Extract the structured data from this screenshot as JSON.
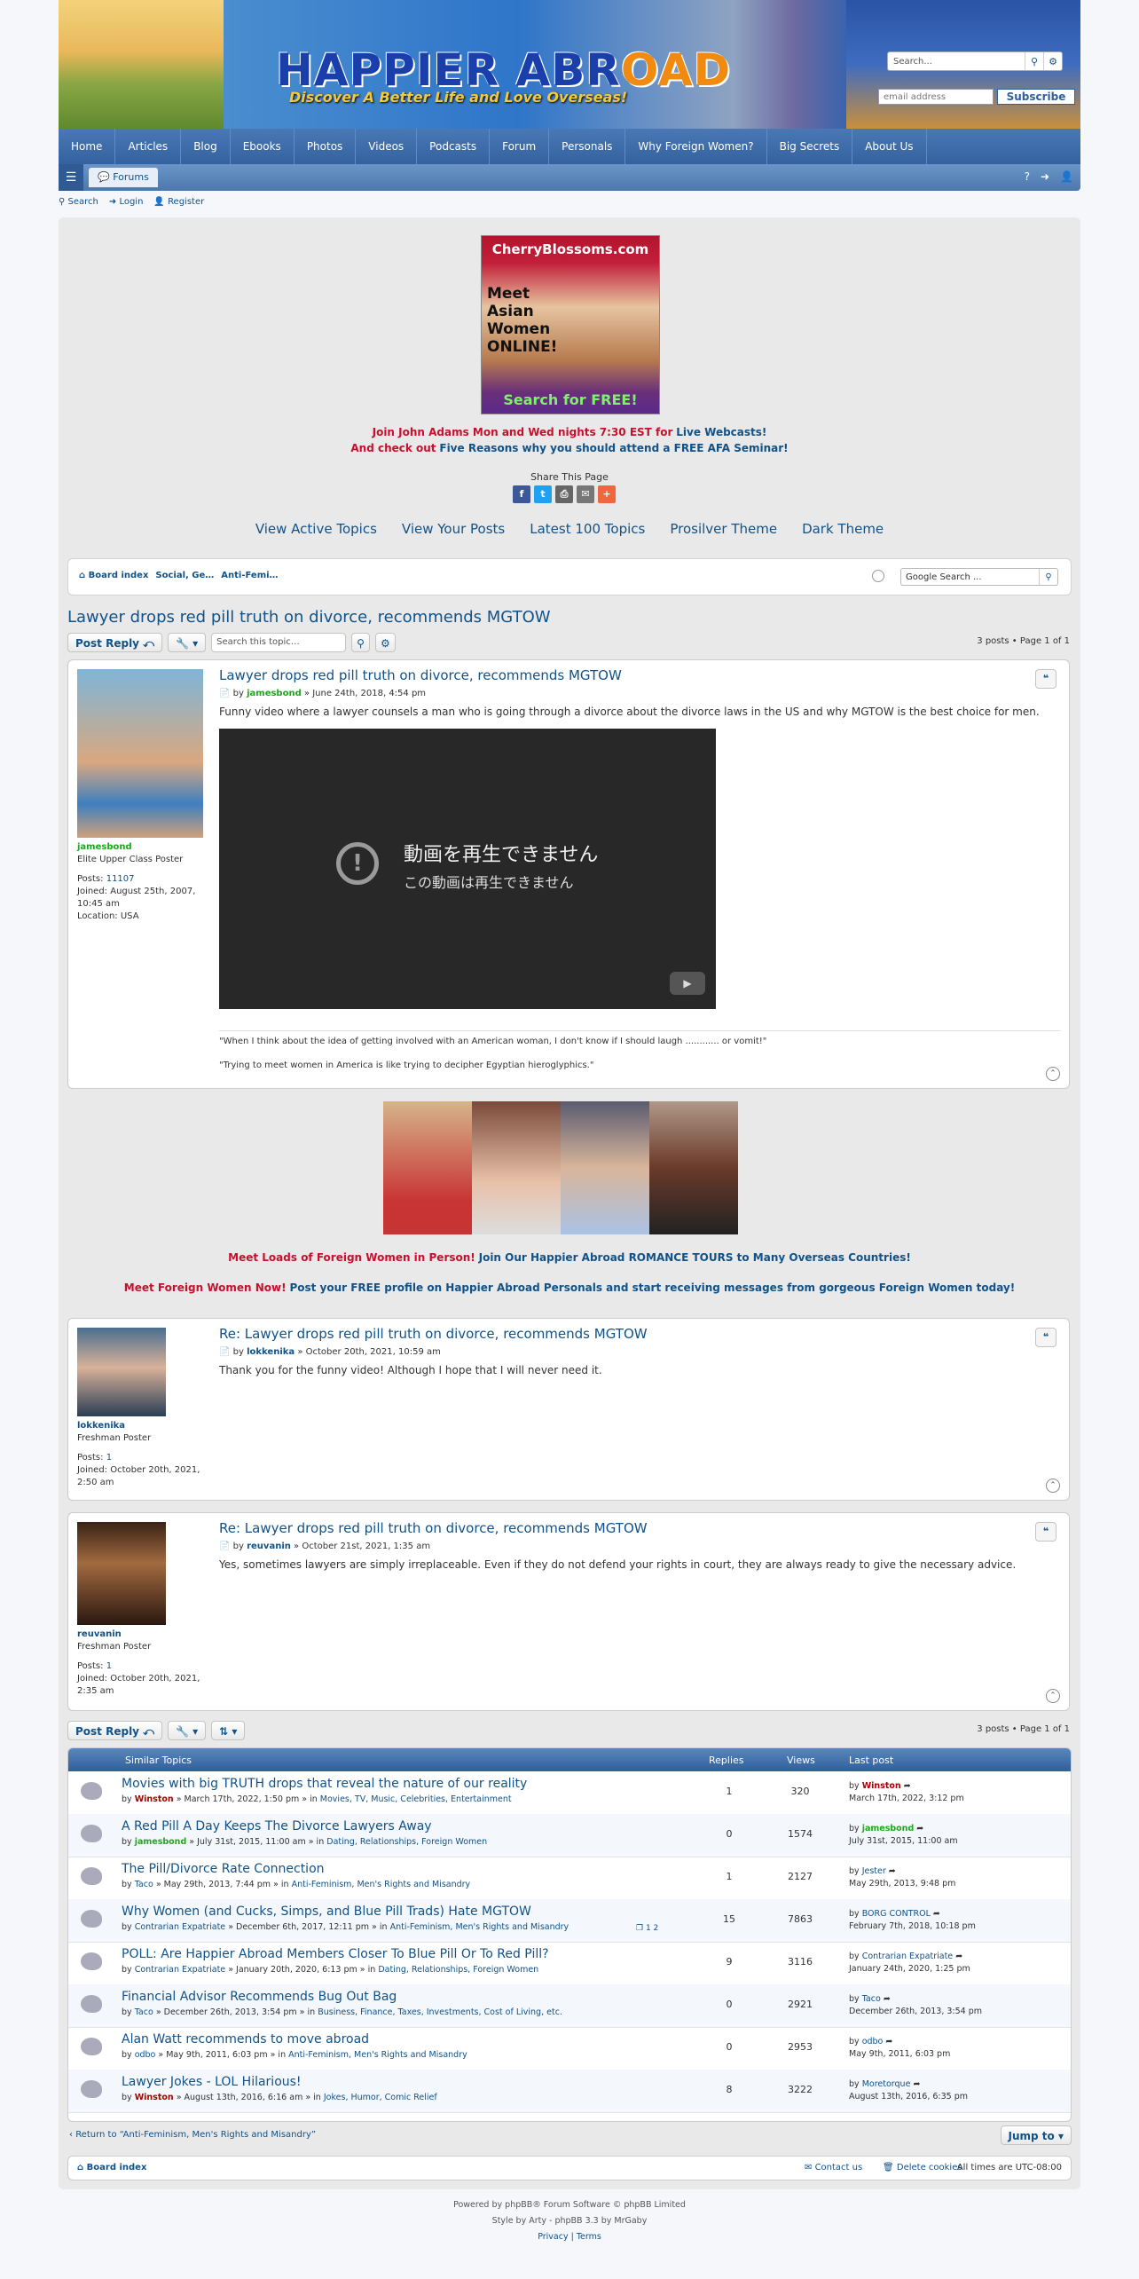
{
  "banner": {
    "logo_a": "HAPPIER ABR",
    "logo_b": "OAD",
    "tagline": "Discover A Better Life and Love Overseas!",
    "search_placeholder": "Search...",
    "email_placeholder": "email address",
    "subscribe": "Subscribe"
  },
  "topnav": [
    "Home",
    "Articles",
    "Blog",
    "Ebooks",
    "Photos",
    "Videos",
    "Podcasts",
    "Forum",
    "Personals",
    "Why Foreign Women?",
    "Big Secrets",
    "About Us"
  ],
  "subnav": {
    "forums": "Forums"
  },
  "quick": {
    "search": "Search",
    "login": "Login",
    "register": "Register"
  },
  "ad1": {
    "site": "CherryBlossoms.com",
    "line": "Meet Asian Women ONLINE!",
    "cta": "Search for FREE!"
  },
  "promo": {
    "l1a": "Join John Adams Mon and Wed nights 7:30 EST for",
    "l1b": "Live Webcasts!",
    "l2a": "And check out",
    "l2b": "Five Reasons why you should attend a FREE AFA Seminar!",
    "share": "Share This Page"
  },
  "links": [
    "View Active Topics",
    "View Your Posts",
    "Latest 100 Topics",
    "Prosilver Theme",
    "Dark Theme"
  ],
  "breadcrumb": {
    "board": "Board index",
    "c1": "Social, Ge…",
    "c2": "Anti-Femi…",
    "google": "Google Search ..."
  },
  "topic": {
    "title": "Lawyer drops red pill truth on divorce, recommends MGTOW",
    "post_reply": "Post Reply",
    "search_placeholder": "Search this topic…",
    "pagination": "3 posts • Page 1 of 1"
  },
  "posts": [
    {
      "title": "Lawyer drops red pill truth on divorce, recommends MGTOW",
      "by": "by",
      "author": "jamesbond",
      "date": "» June 24th, 2018, 4:54 pm",
      "text": "Funny video where a lawyer counsels a man who is going through a divorce about the divorce laws in the US and why MGTOW is the best choice for men.",
      "rank": "Elite Upper Class Poster",
      "posts_label": "Posts:",
      "posts": "11107",
      "joined": "Joined: August 25th, 2007, 10:45 am",
      "location": "Location: USA",
      "video_l1": "動画を再生できません",
      "video_l2": "この動画は再生できません",
      "sig1": "\"When I think about the idea of getting involved with an American woman, I don't know if I should laugh ............ or vomit!\"",
      "sig2": "\"Trying to meet women in America is like trying to decipher Egyptian hieroglyphics.\""
    },
    {
      "title": "Re: Lawyer drops red pill truth on divorce, recommends MGTOW",
      "by": "by",
      "author": "lokkenika",
      "date": "» October 20th, 2021, 10:59 am",
      "text": "Thank you for the funny video! Although I hope that I will never need it.",
      "rank": "Freshman Poster",
      "posts_label": "Posts:",
      "posts": "1",
      "joined": "Joined: October 20th, 2021, 2:50 am"
    },
    {
      "title": "Re: Lawyer drops red pill truth on divorce, recommends MGTOW",
      "by": "by",
      "author": "reuvanin",
      "date": "» October 21st, 2021, 1:35 am",
      "text": "Yes, sometimes lawyers are simply irreplaceable. Even if they do not defend your rights in court, they are always ready to give the necessary advice.",
      "rank": "Freshman Poster",
      "posts_label": "Posts:",
      "posts": "1",
      "joined": "Joined: October 20th, 2021, 2:35 am"
    }
  ],
  "promo2": {
    "a1": "Meet Loads of Foreign Women in Person!",
    "b1": "Join Our Happier Abroad ROMANCE TOURS to Many Overseas Countries!",
    "a2": "Meet Foreign Women Now!",
    "b2": "Post your FREE profile on Happier Abroad Personals and start receiving messages from gorgeous Foreign Women today!"
  },
  "similar": {
    "h_topics": "Similar Topics",
    "h_replies": "Replies",
    "h_views": "Views",
    "h_last": "Last post",
    "rows": [
      {
        "title": "Movies with big TRUTH drops that reveal the nature of our reality",
        "by": "by",
        "author": "Winston",
        "date": "» March 17th, 2022, 1:50 pm » in",
        "forum": "Movies, TV, Music, Celebrities, Entertainment",
        "replies": "1",
        "views": "320",
        "lp_author": "Winston",
        "lp_date": "March 17th, 2022, 3:12 pm"
      },
      {
        "title": "A Red Pill A Day Keeps The Divorce Lawyers Away",
        "by": "by",
        "author": "jamesbond",
        "date": "» July 31st, 2015, 11:00 am » in",
        "forum": "Dating, Relationships, Foreign Women",
        "replies": "0",
        "views": "1574",
        "lp_author": "jamesbond",
        "lp_date": "July 31st, 2015, 11:00 am"
      },
      {
        "title": "The Pill/Divorce Rate Connection",
        "by": "by",
        "author": "Taco",
        "date": "» May 29th, 2013, 7:44 pm » in",
        "forum": "Anti-Feminism, Men's Rights and Misandry",
        "replies": "1",
        "views": "2127",
        "lp_author": "Jester",
        "lp_date": "May 29th, 2013, 9:48 pm"
      },
      {
        "title": "Why Women (and Cucks, Simps, and Blue Pill Trads) Hate MGTOW",
        "by": "by",
        "author": "Contrarian Expatriate",
        "date": "» December 6th, 2017, 12:11 pm » in",
        "forum": "Anti-Feminism, Men's Rights and Misandry",
        "replies": "15",
        "views": "7863",
        "lp_author": "BORG CONTROL",
        "lp_date": "February 7th, 2018, 10:18 pm",
        "pages": "1 2"
      },
      {
        "title": "POLL: Are Happier Abroad Members Closer To Blue Pill Or To Red Pill?",
        "by": "by",
        "author": "Contrarian Expatriate",
        "date": "» January 20th, 2020, 6:13 pm » in",
        "forum": "Dating, Relationships, Foreign Women",
        "replies": "9",
        "views": "3116",
        "lp_author": "Contrarian Expatriate",
        "lp_date": "January 24th, 2020, 1:25 pm"
      },
      {
        "title": "Financial Advisor Recommends Bug Out Bag",
        "by": "by",
        "author": "Taco",
        "date": "» December 26th, 2013, 3:54 pm » in",
        "forum": "Business, Finance, Taxes, Investments, Cost of Living, etc.",
        "replies": "0",
        "views": "2921",
        "lp_author": "Taco",
        "lp_date": "December 26th, 2013, 3:54 pm"
      },
      {
        "title": "Alan Watt recommends to move abroad",
        "by": "by",
        "author": "odbo",
        "date": "» May 9th, 2011, 6:03 pm » in",
        "forum": "Anti-Feminism, Men's Rights and Misandry",
        "replies": "0",
        "views": "2953",
        "lp_author": "odbo",
        "lp_date": "May 9th, 2011, 6:03 pm"
      },
      {
        "title": "Lawyer Jokes - LOL Hilarious!",
        "by": "by",
        "author": "Winston",
        "date": "» August 13th, 2016, 6:16 am » in",
        "forum": "Jokes, Humor, Comic Relief",
        "replies": "8",
        "views": "3222",
        "lp_author": "Moretorque",
        "lp_date": "August 13th, 2016, 6:35 pm"
      }
    ]
  },
  "footer": {
    "return": "Return to “Anti-Feminism, Men's Rights and Misandry”",
    "jump": "Jump to",
    "board": "Board index",
    "contact": "Contact us",
    "delete": "Delete cookies",
    "tz": "All times are UTC-08:00",
    "c1": "Powered by phpBB® Forum Software © phpBB Limited",
    "c2": "Style by Arty - phpBB 3.3 by MrGaby",
    "c3": "Privacy | Terms"
  }
}
